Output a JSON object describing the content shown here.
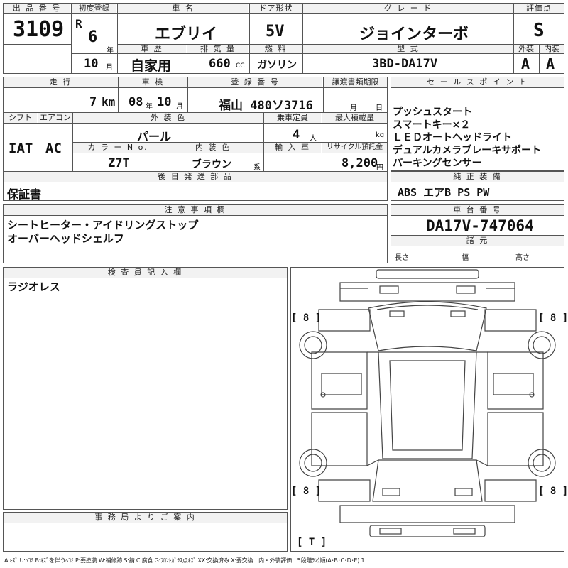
{
  "header": {
    "lot_no_label": "出 品 番 号",
    "lot_no": "3109",
    "first_reg_label": "初度登録",
    "era": "R",
    "year": "6",
    "year_unit": "年",
    "month": "10",
    "month_unit": "月",
    "car_name_label": "車 名",
    "car_name": "エブリイ",
    "door_label": "ドア形状",
    "door": "5V",
    "grade_label": "グ レ ー ド",
    "grade": "ジョインターボ",
    "score_label": "評価点",
    "score": "S",
    "history_label": "車 歴",
    "history": "自家用",
    "displacement_label": "排 気 量",
    "displacement": "660",
    "displacement_unit": "CC",
    "fuel_label": "燃 料",
    "fuel": "ガソリン",
    "model_label": "型 式",
    "model": "3BD-DA17V",
    "exterior_label": "外装",
    "exterior": "A",
    "interior_label": "内装",
    "interior": "A"
  },
  "mid": {
    "mileage_label": "走 行",
    "mileage": "7",
    "mileage_unit": "km",
    "inspection_label": "車 検",
    "insp_year": "08",
    "insp_year_unit": "年",
    "insp_month": "10",
    "insp_month_unit": "月",
    "reg_no_label": "登 録 番 号",
    "reg_no": "福山 480ソ3716",
    "transfer_label": "譲渡書類期限",
    "transfer_month_unit": "月",
    "transfer_day_unit": "日",
    "shift_label": "シフト",
    "shift": "IAT",
    "ac_label": "エアコン",
    "ac": "AC",
    "ext_color_label": "外 装 色",
    "ext_color": "パール",
    "capacity_label": "乗車定員",
    "capacity": "4",
    "capacity_unit": "人",
    "max_load_label": "最大積載量",
    "max_load_unit": "kg",
    "color_no_label": "カ ラ ー N o.",
    "color_no": "Z7T",
    "int_color_label": "内 装 色",
    "int_color": "ブラウン",
    "int_color_unit": "系",
    "import_label": "輸 入 車",
    "recycle_label": "リサイクル預託金",
    "recycle": "8,200",
    "recycle_unit": "円",
    "later_parts_label": "後 日 発 送 部 品",
    "later_parts": "保証書"
  },
  "sales": {
    "label": "セ ー ル ス ポ イ ン ト",
    "items": [
      "プッシュスタート",
      "スマートキー×２",
      "ＬＥＤオートヘッドライト",
      "デュアルカメラブレーキサポート",
      "パーキングセンサー"
    ]
  },
  "equipment": {
    "label": "純 正 装 備",
    "value": "ABS エアB PS PW"
  },
  "notes": {
    "label": "注 意 事 項 欄",
    "lines": [
      "シートヒーター・アイドリングストップ",
      "オーバーヘッドシェルフ"
    ]
  },
  "chassis": {
    "label": "車 台 番 号",
    "value": "DA17V-747064",
    "dims_label": "諸 元",
    "length_label": "長さ",
    "width_label": "幅",
    "height_label": "高さ"
  },
  "inspector": {
    "label": "検 査 員 記 入 欄",
    "text": "ラジオレス"
  },
  "office": {
    "label": "事 務 局 よ り ご 案 内"
  },
  "diagram": {
    "tire_fl": "[ 8 ]",
    "tire_fr": "[ 8 ]",
    "tire_rl": "[ 8 ]",
    "tire_rr": "[ 8 ]",
    "spare": "[ T ]"
  },
  "legend": "A:ｷｽﾞ U:ﾍｺﾐ B:ｷｽﾞを伴うﾍｺﾐ P:要塗装 W:補修跡 S:錆 C:腐食 G:ﾌﾛﾝﾄｶﾞﾗｽ点ｷｽﾞ XX:交換済み X:要交換　内・外装評価　5段階ﾗﾝｸ順(A･B･C･D･E) 1"
}
